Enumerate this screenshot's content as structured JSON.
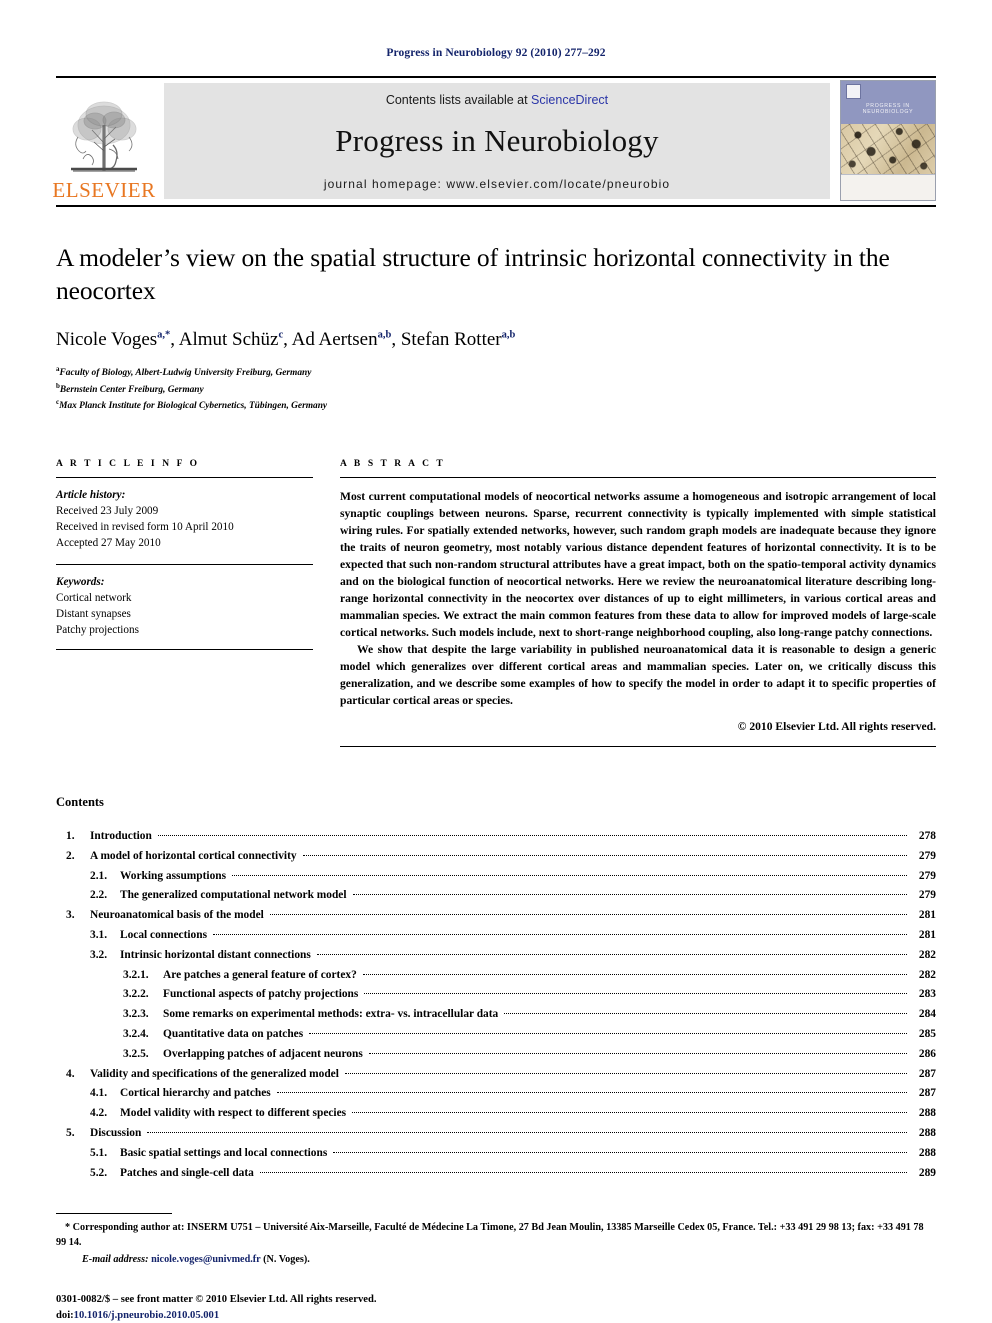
{
  "running_head": "Progress in Neurobiology 92 (2010) 277–292",
  "masthead": {
    "publisher_name": "ELSEVIER",
    "contents_prefix": "Contents lists available at ",
    "contents_link": "ScienceDirect",
    "journal_title": "Progress in Neurobiology",
    "homepage": "journal homepage: www.elsevier.com/locate/pneurobio",
    "cover_title": "PROGRESS IN NEUROBIOLOGY"
  },
  "article": {
    "title": "A modeler’s view on the spatial structure of intrinsic horizontal connectivity in the neocortex",
    "authors": [
      {
        "name": "Nicole Voges",
        "sup": "a,*"
      },
      {
        "name": "Almut Schüz",
        "sup": "c"
      },
      {
        "name": "Ad Aertsen",
        "sup": "a,b"
      },
      {
        "name": "Stefan Rotter",
        "sup": "a,b"
      }
    ],
    "affiliations": [
      {
        "mark": "a",
        "text": "Faculty of Biology, Albert-Ludwig University Freiburg, Germany"
      },
      {
        "mark": "b",
        "text": "Bernstein Center Freiburg, Germany"
      },
      {
        "mark": "c",
        "text": "Max Planck Institute for Biological Cybernetics, Tübingen, Germany"
      }
    ]
  },
  "article_info": {
    "heading": "A R T I C L E   I N F O",
    "history_label": "Article history:",
    "history": [
      "Received 23 July 2009",
      "Received in revised form 10 April 2010",
      "Accepted 27 May 2010"
    ],
    "keywords_label": "Keywords:",
    "keywords": [
      "Cortical network",
      "Distant synapses",
      "Patchy projections"
    ]
  },
  "abstract": {
    "heading": "A B S T R A C T",
    "paragraphs": [
      "Most current computational models of neocortical networks assume a homogeneous and isotropic arrangement of local synaptic couplings between neurons. Sparse, recurrent connectivity is typically implemented with simple statistical wiring rules. For spatially extended networks, however, such random graph models are inadequate because they ignore the traits of neuron geometry, most notably various distance dependent features of horizontal connectivity. It is to be expected that such non-random structural attributes have a great impact, both on the spatio-temporal activity dynamics and on the biological function of neocortical networks. Here we review the neuroanatomical literature describing long-range horizontal connectivity in the neocortex over distances of up to eight millimeters, in various cortical areas and mammalian species. We extract the main common features from these data to allow for improved models of large-scale cortical networks. Such models include, next to short-range neighborhood coupling, also long-range patchy connections.",
      "We show that despite the large variability in published neuroanatomical data it is reasonable to design a generic model which generalizes over different cortical areas and mammalian species. Later on, we critically discuss this generalization, and we describe some examples of how to specify the model in order to adapt it to specific properties of particular cortical areas or species."
    ],
    "copyright": "© 2010 Elsevier Ltd. All rights reserved."
  },
  "contents": {
    "heading": "Contents",
    "entries": [
      {
        "level": 1,
        "num": "1.",
        "label": "Introduction",
        "page": "278"
      },
      {
        "level": 1,
        "num": "2.",
        "label": "A model of horizontal cortical connectivity",
        "page": "279"
      },
      {
        "level": 2,
        "num": "2.1.",
        "label": "Working assumptions",
        "page": "279"
      },
      {
        "level": 2,
        "num": "2.2.",
        "label": "The generalized computational network model",
        "page": "279"
      },
      {
        "level": 1,
        "num": "3.",
        "label": "Neuroanatomical basis of the model",
        "page": "281"
      },
      {
        "level": 2,
        "num": "3.1.",
        "label": "Local connections",
        "page": "281"
      },
      {
        "level": 2,
        "num": "3.2.",
        "label": "Intrinsic horizontal distant connections",
        "page": "282"
      },
      {
        "level": 3,
        "num": "3.2.1.",
        "label": "Are patches a general feature of cortex?",
        "page": "282"
      },
      {
        "level": 3,
        "num": "3.2.2.",
        "label": "Functional aspects of patchy projections",
        "page": "283"
      },
      {
        "level": 3,
        "num": "3.2.3.",
        "label": "Some remarks on experimental methods: extra- vs. intracellular data",
        "page": "284"
      },
      {
        "level": 3,
        "num": "3.2.4.",
        "label": "Quantitative data on patches",
        "page": "285"
      },
      {
        "level": 3,
        "num": "3.2.5.",
        "label": "Overlapping patches of adjacent neurons",
        "page": "286"
      },
      {
        "level": 1,
        "num": "4.",
        "label": "Validity and specifications of the generalized model",
        "page": "287"
      },
      {
        "level": 2,
        "num": "4.1.",
        "label": "Cortical hierarchy and patches",
        "page": "287"
      },
      {
        "level": 2,
        "num": "4.2.",
        "label": "Model validity with respect to different species",
        "page": "288"
      },
      {
        "level": 1,
        "num": "5.",
        "label": "Discussion",
        "page": "288"
      },
      {
        "level": 2,
        "num": "5.1.",
        "label": "Basic spatial settings and local connections",
        "page": "288"
      },
      {
        "level": 2,
        "num": "5.2.",
        "label": "Patches and single-cell data",
        "page": "289"
      }
    ]
  },
  "footnotes": {
    "corresponding": "* Corresponding author at: INSERM U751 – Université Aix-Marseille, Faculté de Médecine La Timone, 27 Bd Jean Moulin, 13385 Marseille Cedex 05, France. Tel.: +33 491 29 98 13; fax: +33 491 78 99 14.",
    "email_label": "E-mail address:",
    "email": "nicole.voges@univmed.fr",
    "email_owner": "(N. Voges).",
    "imprint": "0301-0082/$ – see front matter © 2010 Elsevier Ltd. All rights reserved.",
    "doi_label": "doi:",
    "doi": "10.1016/j.pneurobio.2010.05.001"
  }
}
